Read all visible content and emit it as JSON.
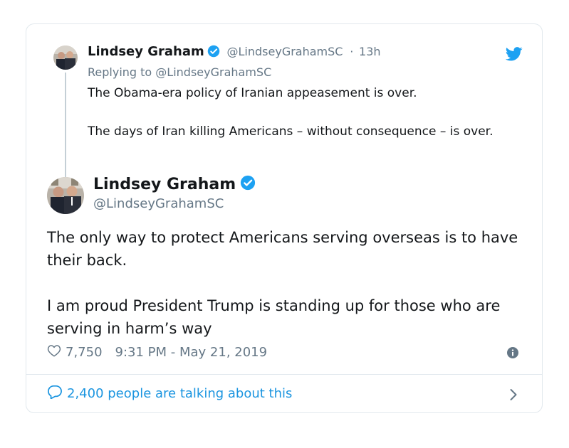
{
  "parent_tweet": {
    "name": "Lindsey Graham",
    "handle": "@LindseyGrahamSC",
    "time_sep": "·",
    "time": "13h",
    "replying_to": "Replying to @LindseyGrahamSC",
    "text": "The Obama-era policy of Iranian appeasement is over.\n\nThe days of Iran killing Americans – without consequence – is over."
  },
  "main_tweet": {
    "name": "Lindsey Graham",
    "handle": "@LindseyGrahamSC",
    "text": "The only way to protect Americans serving overseas is to have their back.\n\nI am proud President Trump is standing up for those who are serving in harm’s way",
    "likes": "7,750",
    "timestamp": "9:31 PM - May 21, 2019"
  },
  "footer": {
    "talking": "2,400 people are talking about this"
  },
  "colors": {
    "accent": "#1b95e0",
    "muted": "#657786",
    "text": "#14171a"
  },
  "icons": [
    "verified-badge-icon",
    "twitter-bird-icon",
    "heart-icon",
    "info-icon",
    "comment-bubble-icon",
    "chevron-right-icon"
  ]
}
